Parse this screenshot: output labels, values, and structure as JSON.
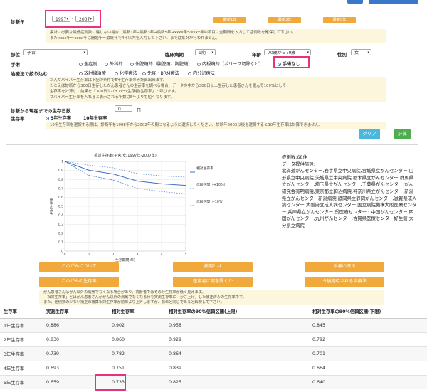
{
  "form": {
    "diag_year_label": "診断年",
    "year_from": "1997",
    "year_sep": "-",
    "year_to": "2007",
    "preset_buttons": [
      "最新1年",
      "最新3年",
      "最新5年"
    ],
    "year_note_1": "集計に必要な最低症例数に達しない場合、最新1年→最新3年→最新5年→xxxx年〜xxxx年の項目に全期間を入力して症例数を確保して下さい。",
    "year_note_2": "またxxxx年〜xxxx年は開始年〜最終年で4年以内を入力して下さい。までは集計が行われません。",
    "site_label": "部位",
    "site_value": "子宮",
    "stage_label": "臨床病期",
    "stage_value": "1期",
    "age_label": "年齢",
    "age_value": "70歳から79歳",
    "sex_label": "性別",
    "sex_value": "女",
    "surgery_label": "手術",
    "surgery_options": [
      "全症例",
      "外科的",
      "体腔鏡的（腹腔鏡、胸腔鏡）",
      "内視鏡的（ポリープ切除など）",
      "手術なし"
    ],
    "therapy_label": "治療法で絞り込む",
    "therapy_options": [
      "放射線治療",
      "化学療法",
      "免疫・BRM療法",
      "内分泌療法"
    ],
    "survival_note_1": "がんサバイバー生存率は下記の条件で5年生存率のみ計算出来ます。",
    "survival_note_2": "たとえば診断から300日生存したがん患者さんの生存率を調べる場合、データの中から300日以上生存した患者さんを選んで100%として",
    "survival_note_3": "生存率を計算し、結果を「300日サバイバー(生存者)生存率」と呼びます。",
    "survival_note_4": "サバイバー生存率を入れると表示される年数は5年よりも短くなります。",
    "days_label": "診断から現在までの生存日数",
    "days_value": "0",
    "days_unit": "日",
    "rate_label": "生存率",
    "rate_options": [
      "5年生存率",
      "10年生存率"
    ],
    "rate_note": "10年生存率を選択する際は、診断年を1998年から2002年の間になるように選択してください。診断年2003以後を選択すると10年生存率は計算できません。",
    "clear_label": "クリア",
    "calc_label": "計算"
  },
  "chart_data": {
    "type": "line",
    "title": "相対生存率(子宮/女/1997年-2007年)",
    "xlabel": "生存期間(年)",
    "ylabel": "相対生存率",
    "x": [
      0,
      1,
      2,
      3,
      4,
      5
    ],
    "xlim": [
      0,
      5
    ],
    "ylim": [
      0,
      1
    ],
    "yticks": [
      "0",
      "0.1",
      "0.2",
      "0.3",
      "0.4",
      "0.5",
      "0.6",
      "0.7",
      "0.8",
      "0.9",
      "1"
    ],
    "series": [
      {
        "name": "相対生存率",
        "values": [
          1.0,
          0.902,
          0.86,
          0.782,
          0.751,
          0.733
        ],
        "style": "solid"
      },
      {
        "name": "信頼区間（+10%）",
        "values": [
          1.0,
          0.958,
          0.929,
          0.864,
          0.839,
          0.825
        ],
        "style": "dashed"
      },
      {
        "name": "信頼区間（-10%）",
        "values": [
          1.0,
          0.845,
          0.792,
          0.701,
          0.664,
          0.64
        ],
        "style": "dashed"
      }
    ],
    "colors": {
      "line": "#3f6fc4"
    }
  },
  "info": {
    "cases": "症例数:68件",
    "provider_label": "データ提供施設:",
    "hospitals": "北海道がんセンター,岩手県立中央病院,宮城県立がんセンター,山形県立中央病院,茨城県立中央病院,栃木県立がんセンター,群馬県立がんセンター,埼玉県立がんセンター,千葉県がんセンター,がん研究会有明病院,東京都立駒込病院,神奈川県立がんセンター,新潟県立がんセンター新潟病院,静岡県立静岡がんセンター,滋賀県成人病センター,大阪府立成人病センター,国立病院機構大阪医療センター,兵庫県立がんセンター,呉医療センター・中国がんセンター,四国がんセンター,九州がんセンター,佐賀県医療センター好生館,大分県立病院"
  },
  "nav_buttons": [
    "このがんについて",
    "病期とは",
    "治療の方法",
    "このがんの生存率",
    "医療者に何を聞くか",
    "今後期待される治療法"
  ],
  "bottom_note_1": "がん患者さんはがん以外の病気でなくなる場合があり、高齢者ではその分生存率が低く見えます。",
  "bottom_note_2": "「相対生存率」とはがん患者さんががん以外の病気でなくなる分を実測生存率に「かさ上げ」した補正済みの生存率です。",
  "bottom_note_3": "また、症例数の少ない補正の概算相対生存率が前年より上昇しますが、前年と同じであると解釈して下さい。",
  "table": {
    "headers": [
      "生存率",
      "実測生存率",
      "相対生存率",
      "相対生存率の90%信頼区間(上限)",
      "相対生存率の90%信頼区間(下限)"
    ],
    "rows": [
      [
        "1年生存率",
        "0.886",
        "0.902",
        "0.958",
        "0.845"
      ],
      [
        "2年生存率",
        "0.830",
        "0.860",
        "0.929",
        "0.792"
      ],
      [
        "3年生存率",
        "0.739",
        "0.782",
        "0.864",
        "0.701"
      ],
      [
        "4年生存率",
        "0.693",
        "0.751",
        "0.839",
        "0.664"
      ],
      [
        "5年生存率",
        "0.659",
        "0.733",
        "0.825",
        "0.640"
      ]
    ]
  },
  "colors": {
    "accent_orange": "#f2a93b",
    "highlight_pink": "#e8337a",
    "clear_blue": "#4bb7df",
    "calc_green": "#4cae4c"
  }
}
